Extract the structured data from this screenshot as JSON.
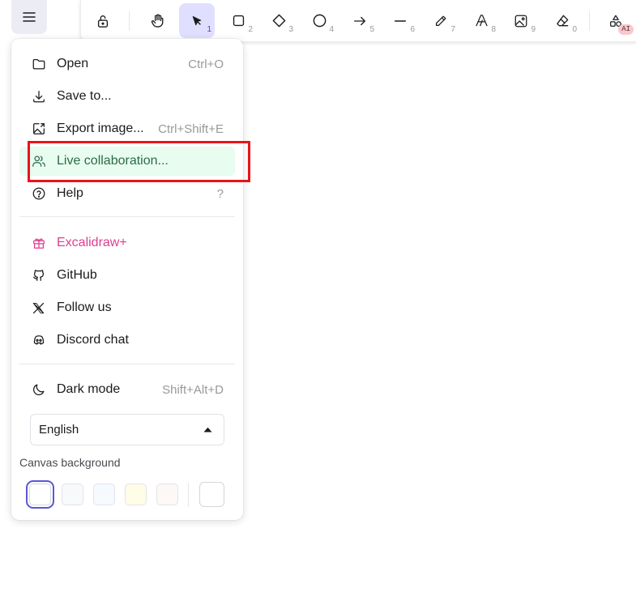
{
  "toolbar": {
    "tools": [
      {
        "icon": "lock-icon",
        "key": ""
      },
      {
        "icon": "hand-icon",
        "key": ""
      },
      {
        "icon": "selection-arrow-icon",
        "key": "1",
        "active": true
      },
      {
        "icon": "rectangle-icon",
        "key": "2"
      },
      {
        "icon": "diamond-icon",
        "key": "3"
      },
      {
        "icon": "ellipse-icon",
        "key": "4"
      },
      {
        "icon": "arrow-icon",
        "key": "5"
      },
      {
        "icon": "line-icon",
        "key": "6"
      },
      {
        "icon": "pencil-icon",
        "key": "7"
      },
      {
        "icon": "text-icon",
        "key": "8"
      },
      {
        "icon": "image-icon",
        "key": "9"
      },
      {
        "icon": "eraser-icon",
        "key": "0"
      },
      {
        "icon": "shapes-ai-icon",
        "key": ""
      }
    ],
    "ai_badge": "AI"
  },
  "menu": {
    "open": {
      "label": "Open",
      "shortcut": "Ctrl+O"
    },
    "save": {
      "label": "Save to..."
    },
    "export": {
      "label": "Export image...",
      "shortcut": "Ctrl+Shift+E"
    },
    "collab": {
      "label": "Live collaboration..."
    },
    "help": {
      "label": "Help",
      "shortcut": "?"
    },
    "plus": {
      "label": "Excalidraw+"
    },
    "github": {
      "label": "GitHub"
    },
    "follow": {
      "label": "Follow us"
    },
    "discord": {
      "label": "Discord chat"
    },
    "dark": {
      "label": "Dark mode",
      "shortcut": "Shift+Alt+D"
    },
    "language": {
      "selected": "English"
    },
    "canvas_background": {
      "label": "Canvas background",
      "swatches": [
        "#ffffff",
        "#f8f9fa",
        "#f5faff",
        "#fffce8",
        "#fdf8f6"
      ],
      "selected_index": 0
    }
  },
  "colors": {
    "accent": "#5b57d1",
    "active_tool_bg": "#e0dfff",
    "highlight_bg": "#e8fcf0",
    "plus_pink": "#e03d8f",
    "annotation_red": "#e8141a"
  }
}
